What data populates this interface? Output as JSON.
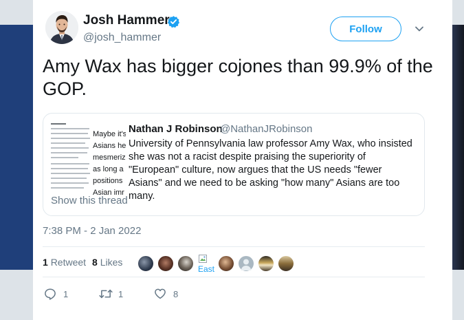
{
  "author": {
    "name": "Josh Hammer",
    "handle": "@josh_hammer",
    "verified": true
  },
  "follow_label": "Follow",
  "tweet_text": "Amy Wax has bigger cojones than 99.9% of the GOP.",
  "quoted_tweet": {
    "author_name": "Nathan J Robinson",
    "author_handle": "@NathanJRobinson",
    "text": "University of Pennsylvania law professor Amy Wax, who insisted she was not a racist despite praising the superiority of \"European\" culture, now argues that the US needs \"fewer Asians\" and we need to be asking \"how many\" Asians are too many.",
    "thumbnail_lines": [
      "Maybe it's",
      "Asians he",
      "mesmeriz",
      "as long a",
      "positions",
      "Asian imr"
    ],
    "show_thread_label": "Show this thread"
  },
  "timestamp": "7:38 PM - 2 Jan 2022",
  "stats": {
    "retweets_count": "1",
    "retweets_label": "Retweet",
    "likes_count": "8",
    "likes_label": "Likes"
  },
  "likers": {
    "broken_avatar_alt": "East"
  },
  "actions": {
    "reply_count": "1",
    "retweet_count": "1",
    "like_count": "8"
  },
  "colors": {
    "accent": "#1da1f2",
    "text_primary": "#14171a",
    "text_secondary": "#657786",
    "border": "#e1e8ed"
  }
}
